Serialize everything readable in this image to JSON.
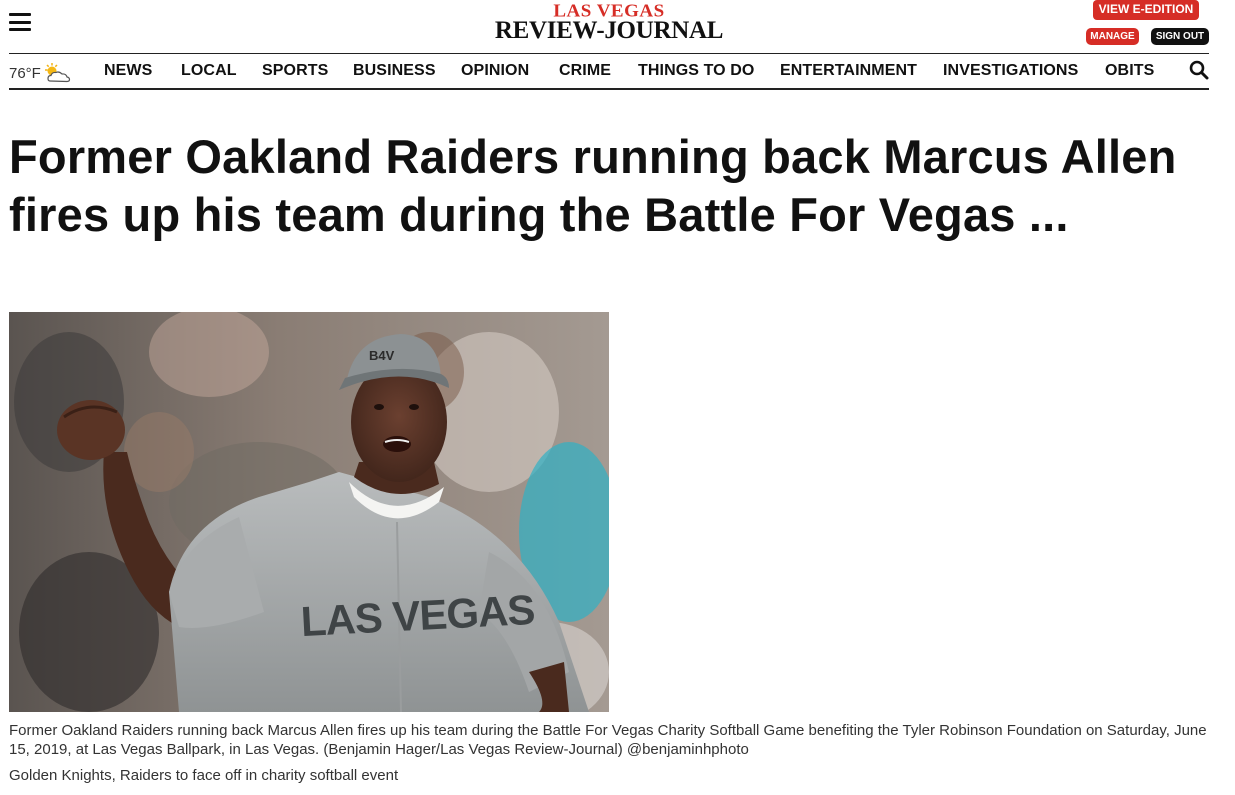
{
  "header": {
    "logo_top": "LAS VEGAS",
    "logo_bottom": "REVIEW-JOURNAL",
    "e_edition_label": "VIEW E-EDITION",
    "manage_label": "MANAGE",
    "signout_label": "SIGN OUT"
  },
  "weather": {
    "temperature": "76°F",
    "icon": "partly-cloudy-icon"
  },
  "nav": {
    "items": [
      "NEWS",
      "LOCAL",
      "SPORTS",
      "BUSINESS",
      "OPINION",
      "CRIME",
      "THINGS TO DO",
      "ENTERTAINMENT",
      "INVESTIGATIONS",
      "OBITS"
    ]
  },
  "article": {
    "headline": "Former Oakland Raiders running back Marcus Allen fires up his team during the Battle For Vegas ...",
    "photo_cap_text": "B4V",
    "photo_jersey_text": "LAS VEGAS",
    "caption": "Former Oakland Raiders running back Marcus Allen fires up his team during the Battle For Vegas Charity Softball Game benefiting the Tyler Robinson Foundation on Saturday, June 15, 2019, at Las Vegas Ballpark, in Las Vegas. (Benjamin Hager/Las Vegas Review-Journal) @benjaminhphoto",
    "related_link": "Golden Knights, Raiders to face off in charity softball event"
  },
  "colors": {
    "brand_red": "#d62d26",
    "text_dark": "#111111"
  }
}
